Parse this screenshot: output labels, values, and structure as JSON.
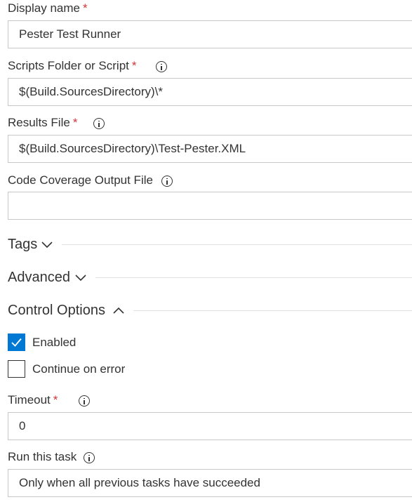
{
  "display_name": {
    "label": "Display name",
    "required_mark": "*",
    "value": "Pester Test Runner"
  },
  "scripts_folder": {
    "label": "Scripts Folder or Script",
    "required_mark": "*",
    "info_icon": "info-icon",
    "value": "$(Build.SourcesDirectory)\\*"
  },
  "results_file": {
    "label": "Results File",
    "required_mark": "*",
    "info_icon": "info-icon",
    "value": "$(Build.SourcesDirectory)\\Test-Pester.XML"
  },
  "code_coverage": {
    "label": "Code Coverage Output File",
    "info_icon": "info-icon",
    "value": ""
  },
  "sections": {
    "tags": {
      "label": "Tags",
      "state": "collapsed",
      "icon": "chevron-down-icon"
    },
    "advanced": {
      "label": "Advanced",
      "state": "collapsed",
      "icon": "chevron-down-icon"
    },
    "control_options": {
      "label": "Control Options",
      "state": "expanded",
      "icon": "chevron-up-icon"
    }
  },
  "enabled": {
    "label": "Enabled",
    "checked": true,
    "icon": "checkmark-icon"
  },
  "continue_on_error": {
    "label": "Continue on error",
    "checked": false
  },
  "timeout": {
    "label": "Timeout",
    "required_mark": "*",
    "info_icon": "info-icon",
    "value": "0"
  },
  "run_this_task": {
    "label": "Run this task",
    "info_icon": "info-icon",
    "value": "Only when all previous tasks have succeeded"
  },
  "colors": {
    "accent": "#0078d4",
    "required": "#d13438",
    "text": "#333333",
    "border": "#c8c8c8"
  }
}
